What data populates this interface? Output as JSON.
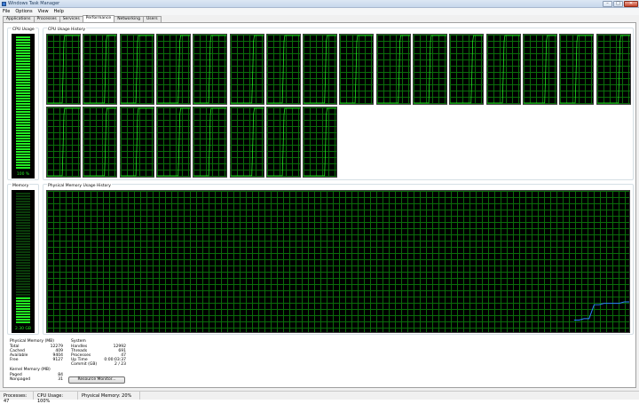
{
  "window": {
    "title": "Windows Task Manager",
    "controls": {
      "minimize": "–",
      "maximize": "□",
      "close": "✕"
    }
  },
  "menu": [
    "File",
    "Options",
    "View",
    "Help"
  ],
  "tabs": [
    "Applications",
    "Processes",
    "Services",
    "Performance",
    "Networking",
    "Users"
  ],
  "active_tab": "Performance",
  "cpu": {
    "usage_label": "CPU Usage",
    "usage_value": "100 %",
    "usage_fraction": 1.0,
    "history_label": "CPU Usage History",
    "core_count": 24
  },
  "memory": {
    "label": "Memory",
    "value": "2.30 GB",
    "usage_fraction": 0.2,
    "history_label": "Physical Memory Usage History",
    "history": [
      0,
      0,
      0,
      0,
      0,
      0,
      0,
      0,
      0,
      0,
      0,
      0,
      0,
      0,
      0,
      0,
      0,
      0,
      0,
      0,
      0,
      0,
      0,
      0,
      0,
      0,
      0,
      0,
      0,
      0,
      0,
      0,
      0,
      0,
      0,
      0,
      0,
      0,
      0,
      0,
      0,
      0,
      0,
      0,
      0,
      0,
      0,
      0,
      0,
      0,
      0,
      0,
      0,
      0,
      0,
      0,
      0,
      0,
      0,
      0,
      0,
      0,
      0,
      0,
      0,
      0,
      0,
      0,
      0,
      0,
      0,
      0,
      0,
      0,
      0,
      0,
      0,
      0,
      0,
      0,
      0,
      0,
      0,
      0,
      0,
      0,
      0,
      0,
      0,
      0,
      0,
      0,
      0,
      0,
      0,
      0,
      0,
      0,
      0,
      0,
      0,
      0,
      0,
      0,
      0,
      0.08,
      0.08,
      0.09,
      0.09,
      0.19,
      0.19,
      0.2,
      0.2,
      0.2,
      0.2,
      0.21,
      0.21
    ]
  },
  "physical_memory": {
    "heading": "Physical Memory (MB)",
    "rows": [
      {
        "label": "Total",
        "value": "12279"
      },
      {
        "label": "Cached",
        "value": "409"
      },
      {
        "label": "Available",
        "value": "9404"
      },
      {
        "label": "Free",
        "value": "9127"
      }
    ]
  },
  "kernel_memory": {
    "heading": "Kernel Memory (MB)",
    "rows": [
      {
        "label": "Paged",
        "value": "84"
      },
      {
        "label": "Nonpaged",
        "value": "31"
      }
    ]
  },
  "system": {
    "heading": "System",
    "rows": [
      {
        "label": "Handles",
        "value": "12992"
      },
      {
        "label": "Threads",
        "value": "691"
      },
      {
        "label": "Processes",
        "value": "47"
      },
      {
        "label": "Up Time",
        "value": "0:00:03:37"
      },
      {
        "label": "Commit (GB)",
        "value": "2 / 23"
      }
    ]
  },
  "resource_monitor_button": "Resource Monitor...",
  "statusbar": {
    "processes": "Processes: 47",
    "cpu": "CPU Usage: 100%",
    "memory": "Physical Memory: 20%"
  },
  "colors": {
    "graph_line_cpu": "#22ee22",
    "graph_line_mem": "#2a7fff",
    "grid": "#0a6d0a"
  }
}
